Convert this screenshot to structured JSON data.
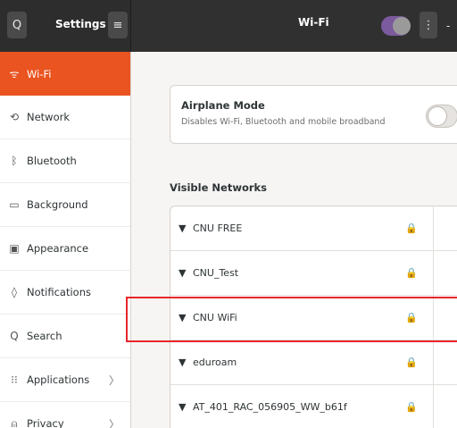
{
  "header": {
    "left_title": "Settings",
    "center_title": "Wi-Fi",
    "search_icon": "Q",
    "menu_icon": "≡",
    "dots_icon": "⋮",
    "minimize_icon": "-"
  },
  "sidebar": {
    "items": [
      {
        "label": "Wi-Fi",
        "icon": "wifi-icon",
        "glyph": "ᯤ"
      },
      {
        "label": "Network",
        "icon": "network-icon",
        "glyph": "⟲"
      },
      {
        "label": "Bluetooth",
        "icon": "bluetooth-icon",
        "glyph": "ᛒ"
      },
      {
        "label": "Background",
        "icon": "background-icon",
        "glyph": "▭"
      },
      {
        "label": "Appearance",
        "icon": "appearance-icon",
        "glyph": "▣"
      },
      {
        "label": "Notifications",
        "icon": "notifications-icon",
        "glyph": "◊"
      },
      {
        "label": "Search",
        "icon": "search-icon",
        "glyph": "Q"
      },
      {
        "label": "Applications",
        "icon": "applications-icon",
        "glyph": "⁝⁝",
        "chevron": "〉"
      },
      {
        "label": "Privacy",
        "icon": "privacy-icon",
        "glyph": "⍝",
        "chevron": "〉"
      }
    ]
  },
  "airplane": {
    "title": "Airplane Mode",
    "subtitle": "Disables Wi-Fi, Bluetooth and mobile broadband"
  },
  "visible_networks": {
    "heading": "Visible Networks",
    "networks": [
      {
        "name": "CNU FREE"
      },
      {
        "name": "CNU_Test"
      },
      {
        "name": "CNU WiFi"
      },
      {
        "name": "eduroam"
      },
      {
        "name": "AT_401_RAC_056905_WW_b61f"
      }
    ],
    "signal_glyph": "▼",
    "lock_glyph": "🔒"
  },
  "colors": {
    "accent": "#e95420",
    "header": "#2d2d2d",
    "highlight": "#e8262a"
  }
}
